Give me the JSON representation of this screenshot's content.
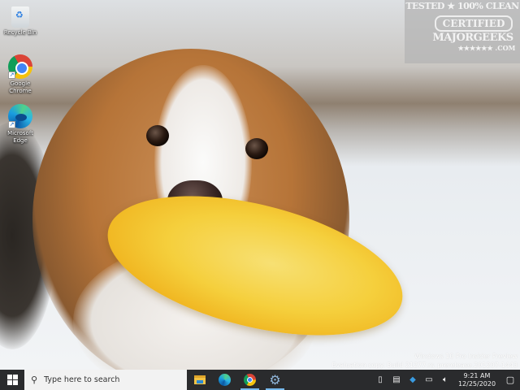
{
  "desktop": {
    "icons": [
      {
        "label": "Recycle Bin",
        "icon": "recycle-bin-icon"
      },
      {
        "label": "Google Chrome",
        "icon": "chrome-icon"
      },
      {
        "label": "Microsoft Edge",
        "icon": "edge-icon"
      }
    ],
    "watermark": {
      "line1": "TESTED ★ 100% CLEAN",
      "line2": "CERTIFIED",
      "line3": "MAJORGEEKS",
      "line4": "★★★★★★ .COM"
    },
    "evaluation": {
      "line1": "Windows 10 Pro Insider Preview",
      "line2": "Evaluation copy. Build 21277.rs_prerelease.201207-1443"
    }
  },
  "taskbar": {
    "search_placeholder": "Type here to search",
    "apps": [
      "File Explorer",
      "Microsoft Edge",
      "Google Chrome",
      "Settings"
    ],
    "tray": {
      "time": "9:21 AM",
      "date": "12/25/2020"
    }
  }
}
